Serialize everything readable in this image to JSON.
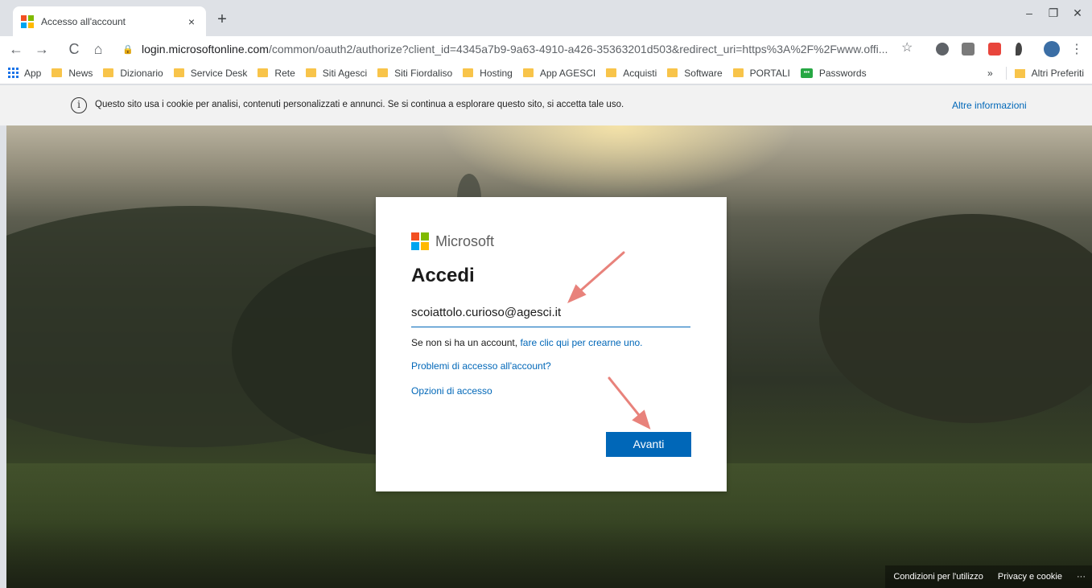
{
  "browser": {
    "tab_title": "Accesso all'account",
    "tab_close": "×",
    "new_tab": "+",
    "window_controls": [
      "–",
      "❐",
      "✕"
    ],
    "url_host": "login.microsoftonline.com",
    "url_path": "/common/oauth2/authorize?client_id=4345a7b9-9a63-4910-a426-35363201d503&redirect_uri=https%3A%2F%2Fwww.offi...",
    "nav": {
      "back": "←",
      "forward": "→",
      "reload": "C",
      "home": "⌂"
    }
  },
  "bookmarks": {
    "apps_label": "App",
    "items": [
      "News",
      "Dizionario",
      "Service Desk",
      "Rete",
      "Siti Agesci",
      "Siti Fiordaliso",
      "Hosting",
      "App AGESCI",
      "Acquisti",
      "Software",
      "PORTALI"
    ],
    "passwords_label": "Passwords",
    "overflow": "»",
    "other": "Altri Preferiti"
  },
  "cookie_bar": {
    "icon": "i",
    "text": "Questo sito usa i cookie per analisi, contenuti personalizzati e annunci. Se si continua a esplorare questo sito, si accetta tale uso.",
    "link": "Altre informazioni"
  },
  "login": {
    "brand": "Microsoft",
    "heading": "Accedi",
    "email_value": "scoiattolo.curioso@agesci.it",
    "no_account_text": "Se non si ha un account,",
    "create_link": "fare clic qui per crearne uno.",
    "problems_link": "Problemi di accesso all'account?",
    "options_link": "Opzioni di accesso",
    "next_button": "Avanti"
  },
  "footer": {
    "terms": "Condizioni per l'utilizzo",
    "privacy": "Privacy e cookie",
    "more": "···"
  },
  "colors": {
    "ms_red": "#f25022",
    "ms_green": "#7fba00",
    "ms_blue": "#00a4ef",
    "ms_yellow": "#ffb900",
    "accent": "#0067b8",
    "annotation_arrow": "#e8827b"
  }
}
